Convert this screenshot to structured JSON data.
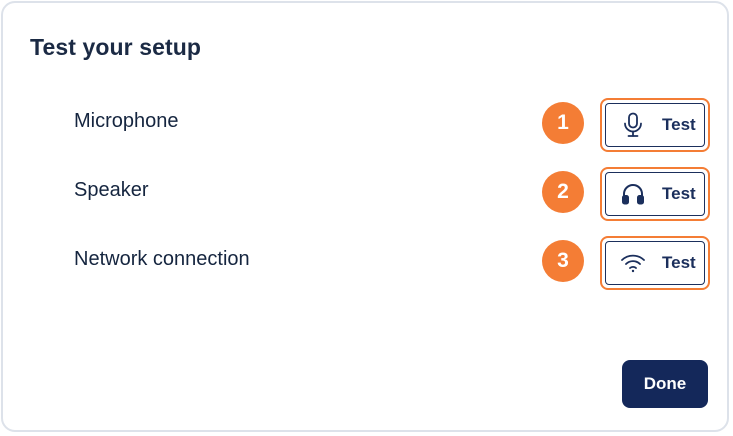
{
  "dialog": {
    "title": "Test your setup"
  },
  "items": [
    {
      "label": "Microphone",
      "step": "1",
      "button_label": "Test",
      "icon": "microphone-icon"
    },
    {
      "label": "Speaker",
      "step": "2",
      "button_label": "Test",
      "icon": "headphones-icon"
    },
    {
      "label": "Network connection",
      "step": "3",
      "button_label": "Test",
      "icon": "wifi-icon"
    }
  ],
  "footer": {
    "done_label": "Done"
  },
  "colors": {
    "accent_orange": "#f47d35",
    "primary_navy": "#14285a",
    "text_dark": "#1b2a44",
    "border": "#dde2ea"
  }
}
